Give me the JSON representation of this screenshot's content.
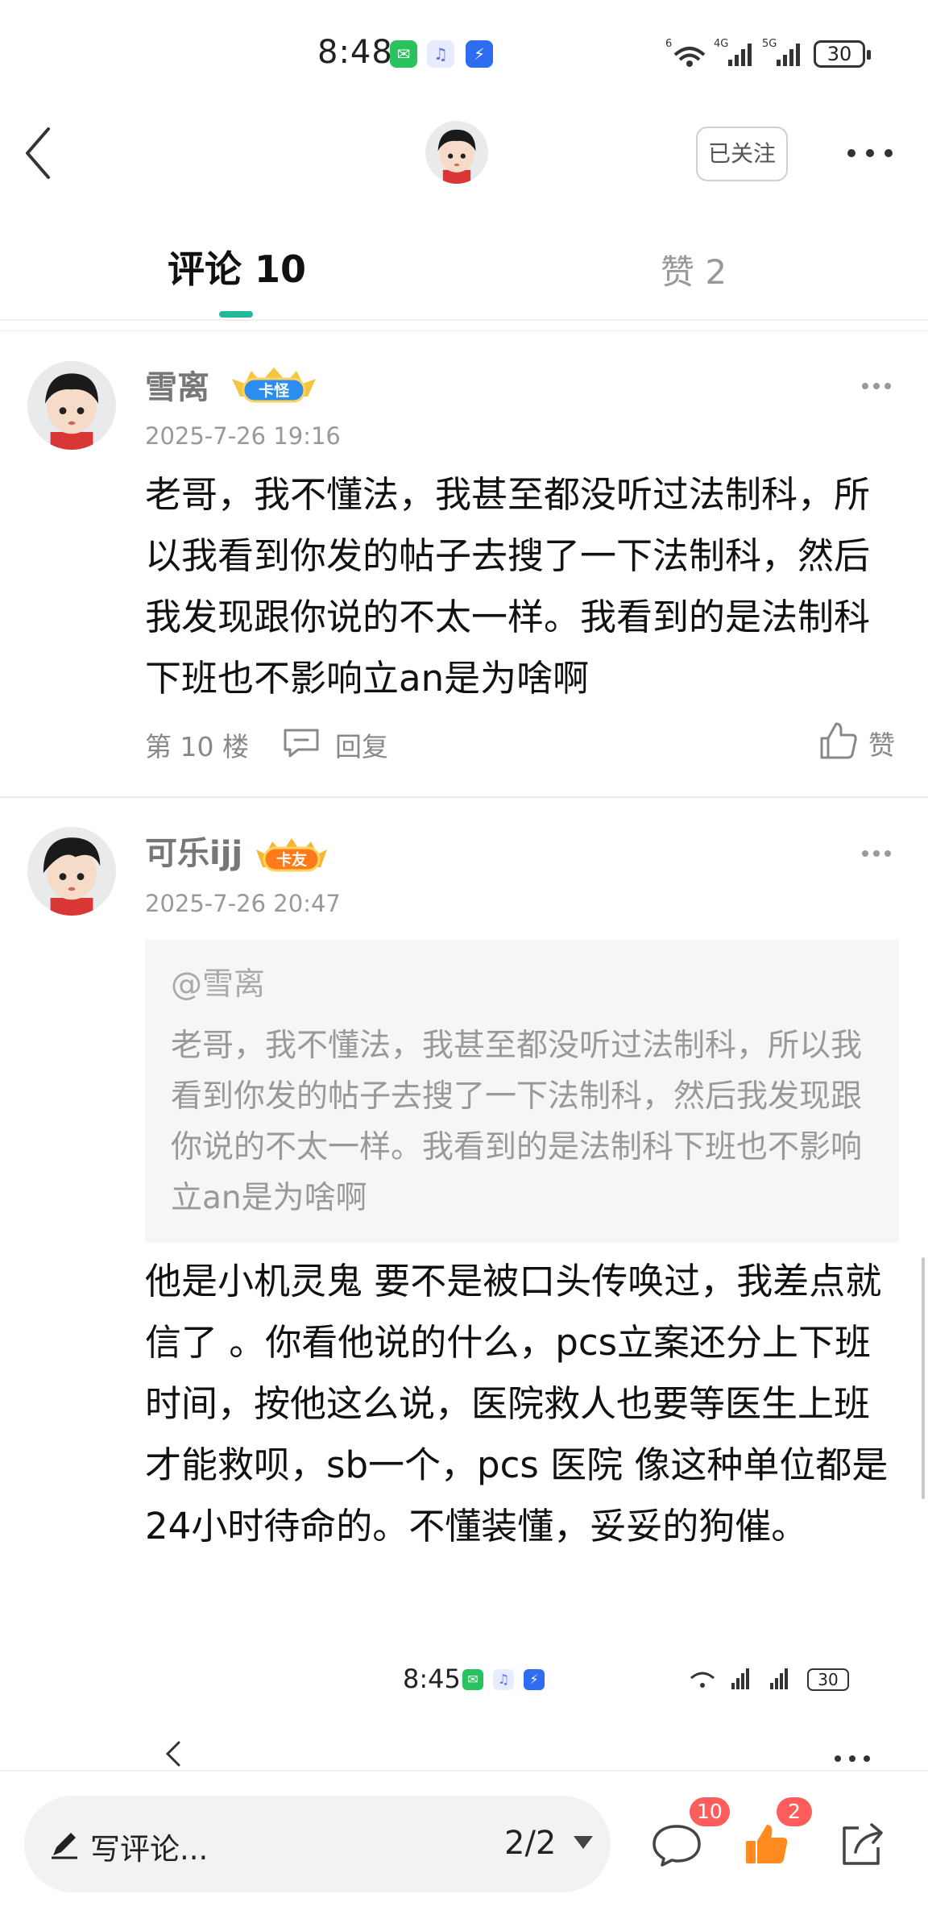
{
  "status_bar": {
    "time": "8:48",
    "network_left": "6",
    "network_4g": "4G",
    "network_5g": "5G",
    "battery": "30"
  },
  "header": {
    "follow_label": "已关注"
  },
  "tabs": [
    {
      "label": "评论 10"
    },
    {
      "label": "赞 2"
    }
  ],
  "comments": [
    {
      "username": "雪离",
      "badge": "卡怪",
      "time": "2025-7-26 19:16",
      "text": "老哥，我不懂法，我甚至都没听过法制科，所以我看到你发的帖子去搜了一下法制科，然后我发现跟你说的不太一样。我看到的是法制科下班也不影响立an是为啥啊",
      "floor": "第 10 楼",
      "reply_label": "回复",
      "like_label": "赞"
    },
    {
      "username": "可乐ijj",
      "badge": "卡友",
      "time": "2025-7-26 20:47",
      "quote_user": "@雪离",
      "quote_text": "老哥，我不懂法，我甚至都没听过法制科，所以我看到你发的帖子去搜了一下法制科，然后我发现跟你说的不太一样。我看到的是法制科下班也不影响立an是为啥啊",
      "text": "他是小机灵鬼 要不是被口头传唤过，我差点就信了 。你看他说的什么，pcs立案还分上下班时间，按他这么说，医院救人也要等医生上班才能救呗，sb一个，pcs 医院 像这种单位都是24小时待命的。不懂装懂，妥妥的狗催。"
    }
  ],
  "embedded_screenshot": {
    "time": "8:45",
    "battery": "30"
  },
  "bottom_bar": {
    "write_placeholder": "写评论...",
    "page_indicator": "2/2",
    "comment_count": "10",
    "like_count": "2"
  },
  "colors": {
    "accent": "#22b89a",
    "badge_red": "#ff5c5c",
    "like_orange": "#ff8a1f"
  }
}
